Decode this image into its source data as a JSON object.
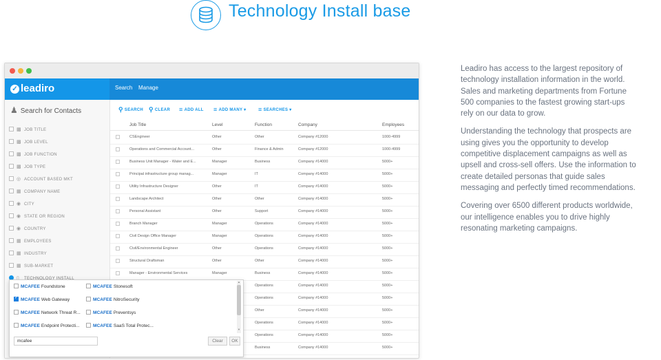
{
  "header": {
    "title": "Technology Install base",
    "icon": "database-icon",
    "accent_color": "#1a9be6"
  },
  "app": {
    "logo_text": "leadiro",
    "tabs": [
      "Search",
      "Manage"
    ],
    "sidebar_search_label": "Search for Contacts",
    "filters": [
      {
        "label": "JOB TITLE",
        "icon": "chart-icon"
      },
      {
        "label": "JOB LEVEL",
        "icon": "chart-icon"
      },
      {
        "label": "JOB FUNCTION",
        "icon": "chart-icon"
      },
      {
        "label": "JOB TYPE",
        "icon": "chart-icon"
      },
      {
        "label": "ACCOUNT BASED MKT",
        "icon": "target-icon"
      },
      {
        "label": "COMPANY NAME",
        "icon": "building-icon"
      },
      {
        "label": "CITY",
        "icon": "globe-icon"
      },
      {
        "label": "STATE OR REGION",
        "icon": "globe-icon"
      },
      {
        "label": "COUNTRY",
        "icon": "globe-icon"
      },
      {
        "label": "EMPLOYEES",
        "icon": "building-icon"
      },
      {
        "label": "INDUSTRY",
        "icon": "building-icon"
      },
      {
        "label": "SUB-MARKET",
        "icon": "building-icon"
      },
      {
        "label": "TECHNOLOGY INSTALL",
        "icon": "device-icon"
      }
    ],
    "toolbar": {
      "search": "SEARCH",
      "clear": "CLEAR",
      "add_all": "ADD ALL",
      "add_many": "ADD MANY",
      "searches": "SEARCHES"
    },
    "table": {
      "headers": [
        "Job Title",
        "Level",
        "Function",
        "Company",
        "Employees"
      ],
      "rows": [
        [
          "CSEngineer",
          "Other",
          "Other",
          "Company #12000",
          "1000-4999"
        ],
        [
          "Operations and Commercial Account...",
          "Other",
          "Finance & Admin",
          "Company #12000",
          "1000-4999"
        ],
        [
          "Business Unit Manager - Water and E...",
          "Manager",
          "Business",
          "Company #14000",
          "5000+"
        ],
        [
          "Principal infrastructure group manag...",
          "Manager",
          "IT",
          "Company #14000",
          "5000+"
        ],
        [
          "Utility Infrastructure Designer",
          "Other",
          "IT",
          "Company #14000",
          "5000+"
        ],
        [
          "Landscape Architect",
          "Other",
          "Other",
          "Company #14000",
          "5000+"
        ],
        [
          "Personal Assistant",
          "Other",
          "Support",
          "Company #14000",
          "5000+"
        ],
        [
          "Branch Manager",
          "Manager",
          "Operations",
          "Company #14000",
          "5000+"
        ],
        [
          "Civil Design Office Manager",
          "Manager",
          "Operations",
          "Company #14000",
          "5000+"
        ],
        [
          "Civil/Environmental Engineer",
          "Other",
          "Operations",
          "Company #14000",
          "5000+"
        ],
        [
          "Structural Draftsman",
          "Other",
          "Other",
          "Company #14000",
          "5000+"
        ],
        [
          "Manager - Environmental Services",
          "Manager",
          "Business",
          "Company #14000",
          "5000+"
        ],
        [
          "",
          "",
          "Operations",
          "Company #14000",
          "5000+"
        ],
        [
          "",
          "",
          "Operations",
          "Company #14000",
          "5000+"
        ],
        [
          "",
          "",
          "Other",
          "Company #14000",
          "5000+"
        ],
        [
          "",
          "",
          "Operations",
          "Company #14000",
          "5000+"
        ],
        [
          "",
          "",
          "Operations",
          "Company #14000",
          "5000+"
        ],
        [
          "",
          "",
          "Business",
          "Company #14000",
          "5000+"
        ]
      ]
    },
    "popup": {
      "brand": "MCAFEE",
      "options": [
        {
          "label": "Foundstone",
          "checked": false
        },
        {
          "label": "Stonesoft",
          "checked": false
        },
        {
          "label": "Web Gateway",
          "checked": true
        },
        {
          "label": "NitroSecurity",
          "checked": false
        },
        {
          "label": "Network Threat R...",
          "checked": false
        },
        {
          "label": "Preventsys",
          "checked": false
        },
        {
          "label": "Endpoint Protecti...",
          "checked": false
        },
        {
          "label": "SaaS Total Protec...",
          "checked": false
        }
      ],
      "input_value": "mcafee",
      "clear_label": "Clear",
      "ok_label": "OK"
    }
  },
  "copy": [
    "Leadiro has access to the largest repository of technology installation information in the world. Sales and marketing departments from Fortune 500 companies to the fastest growing start-ups rely on our data to grow.",
    "Understanding the technology that prospects are using gives you the opportunity to develop competitive displacement campaigns as well as upsell and cross-sell offers. Use the information to create detailed personas that guide sales messaging and perfectly timed recommendations.",
    "Covering over 6500 different products worldwide, our intelligence enables you to drive highly resonating marketing campaigns."
  ]
}
